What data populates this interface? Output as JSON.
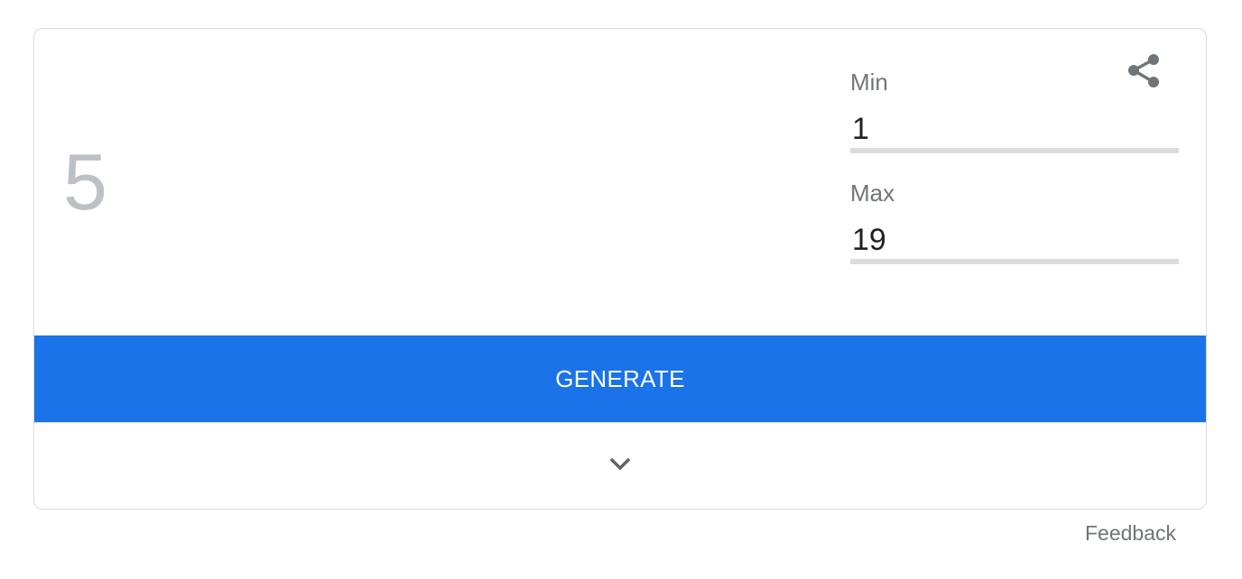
{
  "result": {
    "value": "5"
  },
  "fields": {
    "min_label": "Min",
    "min_value": "1",
    "max_label": "Max",
    "max_value": "19"
  },
  "actions": {
    "generate_label": "GENERATE"
  },
  "icons": {
    "share": "share-icon",
    "expand": "chevron-down-icon"
  },
  "footer": {
    "feedback_label": "Feedback"
  },
  "colors": {
    "accent": "#1a73e8",
    "result_text": "#bdc1c6",
    "label_text": "#70757a",
    "underline": "#dadce0"
  }
}
